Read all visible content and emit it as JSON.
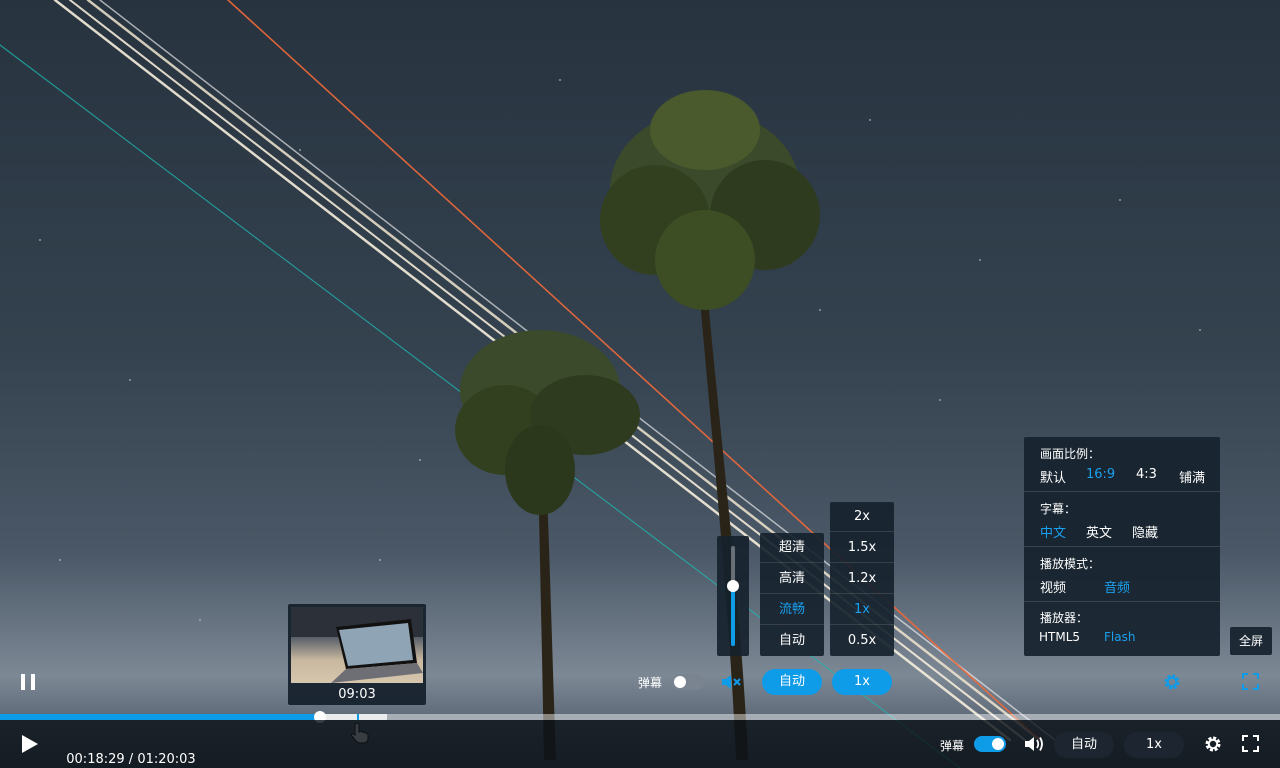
{
  "colors": {
    "accent": "#0e9be8",
    "panel": "#16222d",
    "bar": "#0c1218"
  },
  "preview": {
    "time": "09:03"
  },
  "overlay_controls": {
    "danmaku_label": "弹幕",
    "danmaku_on": false,
    "quality_button": "自动",
    "speed_button": "1x",
    "fullscreen_tip": "全屏",
    "volume_level": 0.6
  },
  "quality_menu": {
    "items": [
      {
        "label": "超清",
        "selected": false
      },
      {
        "label": "高清",
        "selected": false
      },
      {
        "label": "流畅",
        "selected": true
      },
      {
        "label": "自动",
        "selected": false
      }
    ]
  },
  "speed_menu": {
    "items": [
      {
        "label": "2x",
        "selected": false
      },
      {
        "label": "1.5x",
        "selected": false
      },
      {
        "label": "1.2x",
        "selected": false
      },
      {
        "label": "1x",
        "selected": true
      },
      {
        "label": "0.5x",
        "selected": false
      }
    ]
  },
  "settings": {
    "aspect": {
      "title": "画面比例：",
      "options": [
        "默认",
        "16:9",
        "4:3",
        "铺满"
      ],
      "selected": "16:9"
    },
    "subtitle": {
      "title": "字幕：",
      "options": [
        "中文",
        "英文",
        "隐藏"
      ],
      "selected": "中文"
    },
    "mode": {
      "title": "播放模式：",
      "options": [
        "视频",
        "音频"
      ],
      "selected": "音频"
    },
    "player": {
      "title": "播放器：",
      "options": [
        "HTML5",
        "Flash"
      ],
      "selected": "Flash"
    }
  },
  "progress": {
    "played_fraction": 0.25,
    "buffered_fraction": 0.302,
    "hover_fraction": 0.279
  },
  "bottom_bar": {
    "time_current": "00:18:29",
    "time_separator": " / ",
    "time_total": "01:20:03",
    "danmaku_label": "弹幕",
    "danmaku_on": true,
    "quality_button": "自动",
    "speed_button": "1x"
  },
  "icons": [
    "pause-icon",
    "play-icon",
    "mute-icon",
    "volume-icon",
    "gear-icon",
    "fullscreen-icon",
    "hand-cursor-icon"
  ]
}
